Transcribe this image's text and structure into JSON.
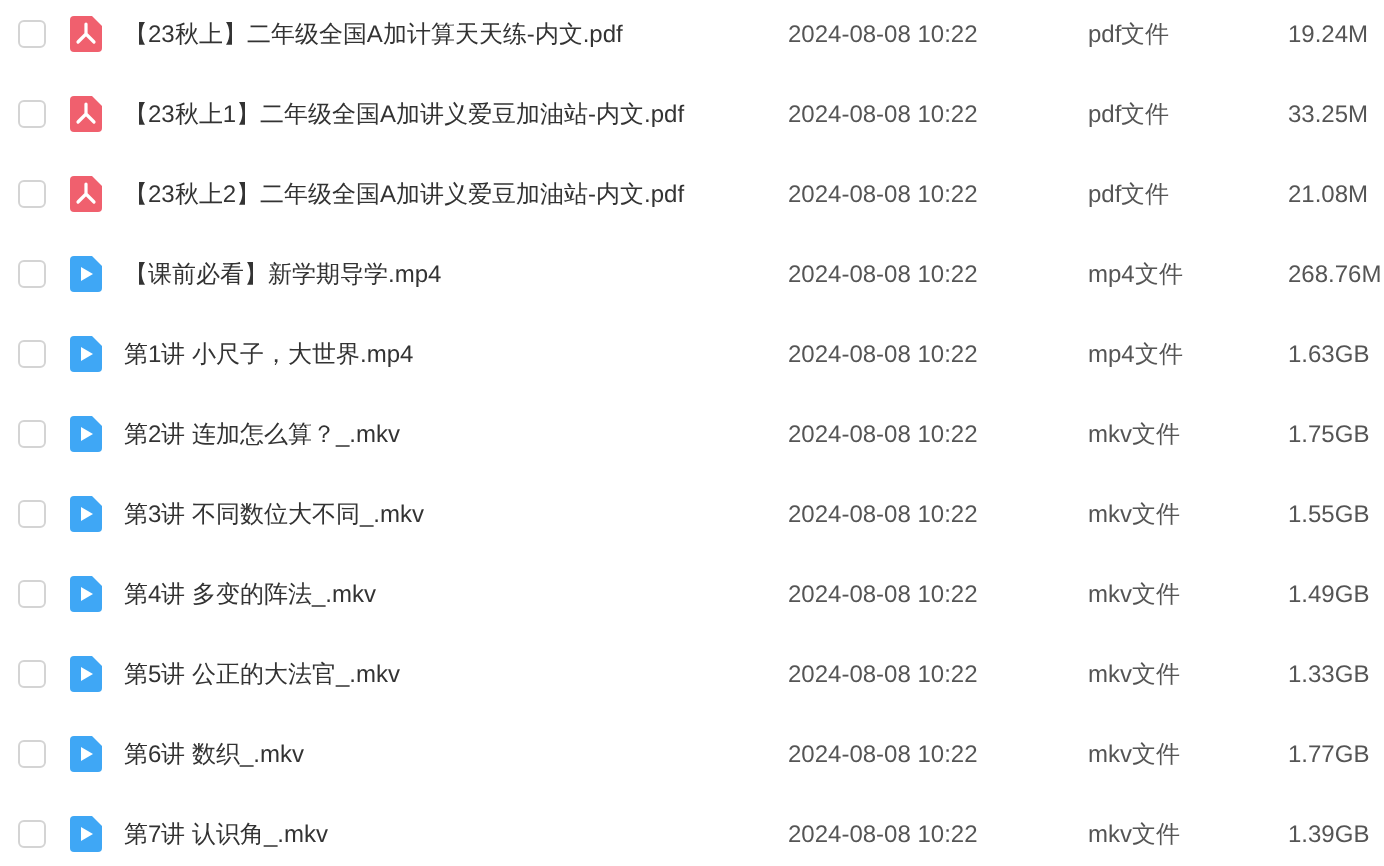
{
  "files": [
    {
      "name": "【23秋上】二年级全国A加计算天天练-内文.pdf",
      "kind": "pdf",
      "checked": false,
      "date": "2024-08-08 10:22",
      "type": "pdf文件",
      "size": "19.24M"
    },
    {
      "name": "【23秋上1】二年级全国A加讲义爱豆加油站-内文.pdf",
      "kind": "pdf",
      "checked": false,
      "date": "2024-08-08 10:22",
      "type": "pdf文件",
      "size": "33.25M"
    },
    {
      "name": "【23秋上2】二年级全国A加讲义爱豆加油站-内文.pdf",
      "kind": "pdf",
      "checked": false,
      "date": "2024-08-08 10:22",
      "type": "pdf文件",
      "size": "21.08M"
    },
    {
      "name": "【课前必看】新学期导学.mp4",
      "kind": "video",
      "checked": false,
      "date": "2024-08-08 10:22",
      "type": "mp4文件",
      "size": "268.76M"
    },
    {
      "name": "第1讲 小尺子，大世界.mp4",
      "kind": "video",
      "checked": false,
      "date": "2024-08-08 10:22",
      "type": "mp4文件",
      "size": "1.63GB"
    },
    {
      "name": "第2讲 连加怎么算？_.mkv",
      "kind": "video",
      "checked": false,
      "date": "2024-08-08 10:22",
      "type": "mkv文件",
      "size": "1.75GB"
    },
    {
      "name": "第3讲 不同数位大不同_.mkv",
      "kind": "video",
      "checked": false,
      "date": "2024-08-08 10:22",
      "type": "mkv文件",
      "size": "1.55GB"
    },
    {
      "name": "第4讲 多变的阵法_.mkv",
      "kind": "video",
      "checked": false,
      "date": "2024-08-08 10:22",
      "type": "mkv文件",
      "size": "1.49GB"
    },
    {
      "name": "第5讲 公正的大法官_.mkv",
      "kind": "video",
      "checked": false,
      "date": "2024-08-08 10:22",
      "type": "mkv文件",
      "size": "1.33GB"
    },
    {
      "name": "第6讲 数织_.mkv",
      "kind": "video",
      "checked": false,
      "date": "2024-08-08 10:22",
      "type": "mkv文件",
      "size": "1.77GB"
    },
    {
      "name": "第7讲 认识角_.mkv",
      "kind": "video",
      "checked": false,
      "date": "2024-08-08 10:22",
      "type": "mkv文件",
      "size": "1.39GB"
    }
  ]
}
